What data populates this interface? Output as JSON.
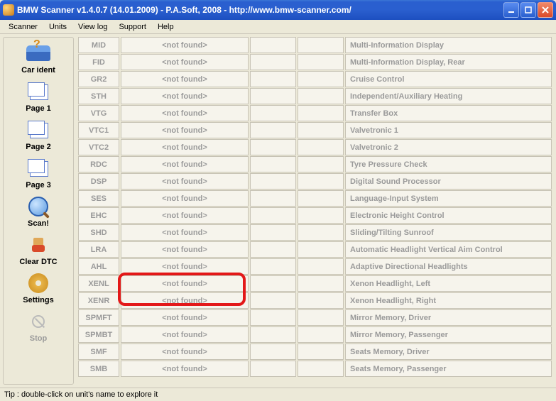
{
  "window": {
    "title": "BMW Scanner v1.4.0.7 (14.01.2009) - P.A.Soft, 2008 - http://www.bmw-scanner.com/"
  },
  "menu": {
    "scanner": "Scanner",
    "units": "Units",
    "viewlog": "View log",
    "support": "Support",
    "help": "Help"
  },
  "sidebar": {
    "carident": "Car ident",
    "page1": "Page 1",
    "page2": "Page 2",
    "page3": "Page 3",
    "scan": "Scan!",
    "cleardtc": "Clear DTC",
    "settings": "Settings",
    "stop": "Stop"
  },
  "status_text": "<not found>",
  "units": [
    {
      "abbr": "MID",
      "desc": "Multi-Information Display"
    },
    {
      "abbr": "FID",
      "desc": "Multi-Information Display, Rear"
    },
    {
      "abbr": "GR2",
      "desc": "Cruise Control"
    },
    {
      "abbr": "STH",
      "desc": "Independent/Auxiliary Heating"
    },
    {
      "abbr": "VTG",
      "desc": "Transfer Box"
    },
    {
      "abbr": "VTC1",
      "desc": "Valvetronic 1"
    },
    {
      "abbr": "VTC2",
      "desc": "Valvetronic 2"
    },
    {
      "abbr": "RDC",
      "desc": "Tyre Pressure Check"
    },
    {
      "abbr": "DSP",
      "desc": "Digital Sound Processor"
    },
    {
      "abbr": "SES",
      "desc": "Language-Input System"
    },
    {
      "abbr": "EHC",
      "desc": "Electronic Height Control"
    },
    {
      "abbr": "SHD",
      "desc": "Sliding/Tilting Sunroof"
    },
    {
      "abbr": "LRA",
      "desc": "Automatic Headlight Vertical Aim Control"
    },
    {
      "abbr": "AHL",
      "desc": "Adaptive Directional Headlights"
    },
    {
      "abbr": "XENL",
      "desc": "Xenon Headlight, Left"
    },
    {
      "abbr": "XENR",
      "desc": "Xenon Headlight, Right"
    },
    {
      "abbr": "SPMFT",
      "desc": "Mirror Memory, Driver"
    },
    {
      "abbr": "SPMBT",
      "desc": "Mirror Memory, Passenger"
    },
    {
      "abbr": "SMF",
      "desc": "Seats Memory, Driver"
    },
    {
      "abbr": "SMB",
      "desc": "Seats Memory, Passenger"
    }
  ],
  "highlight": {
    "rows": [
      14,
      15
    ]
  },
  "statusbar": {
    "tip": "Tip : double-click on unit's name to explore it"
  }
}
